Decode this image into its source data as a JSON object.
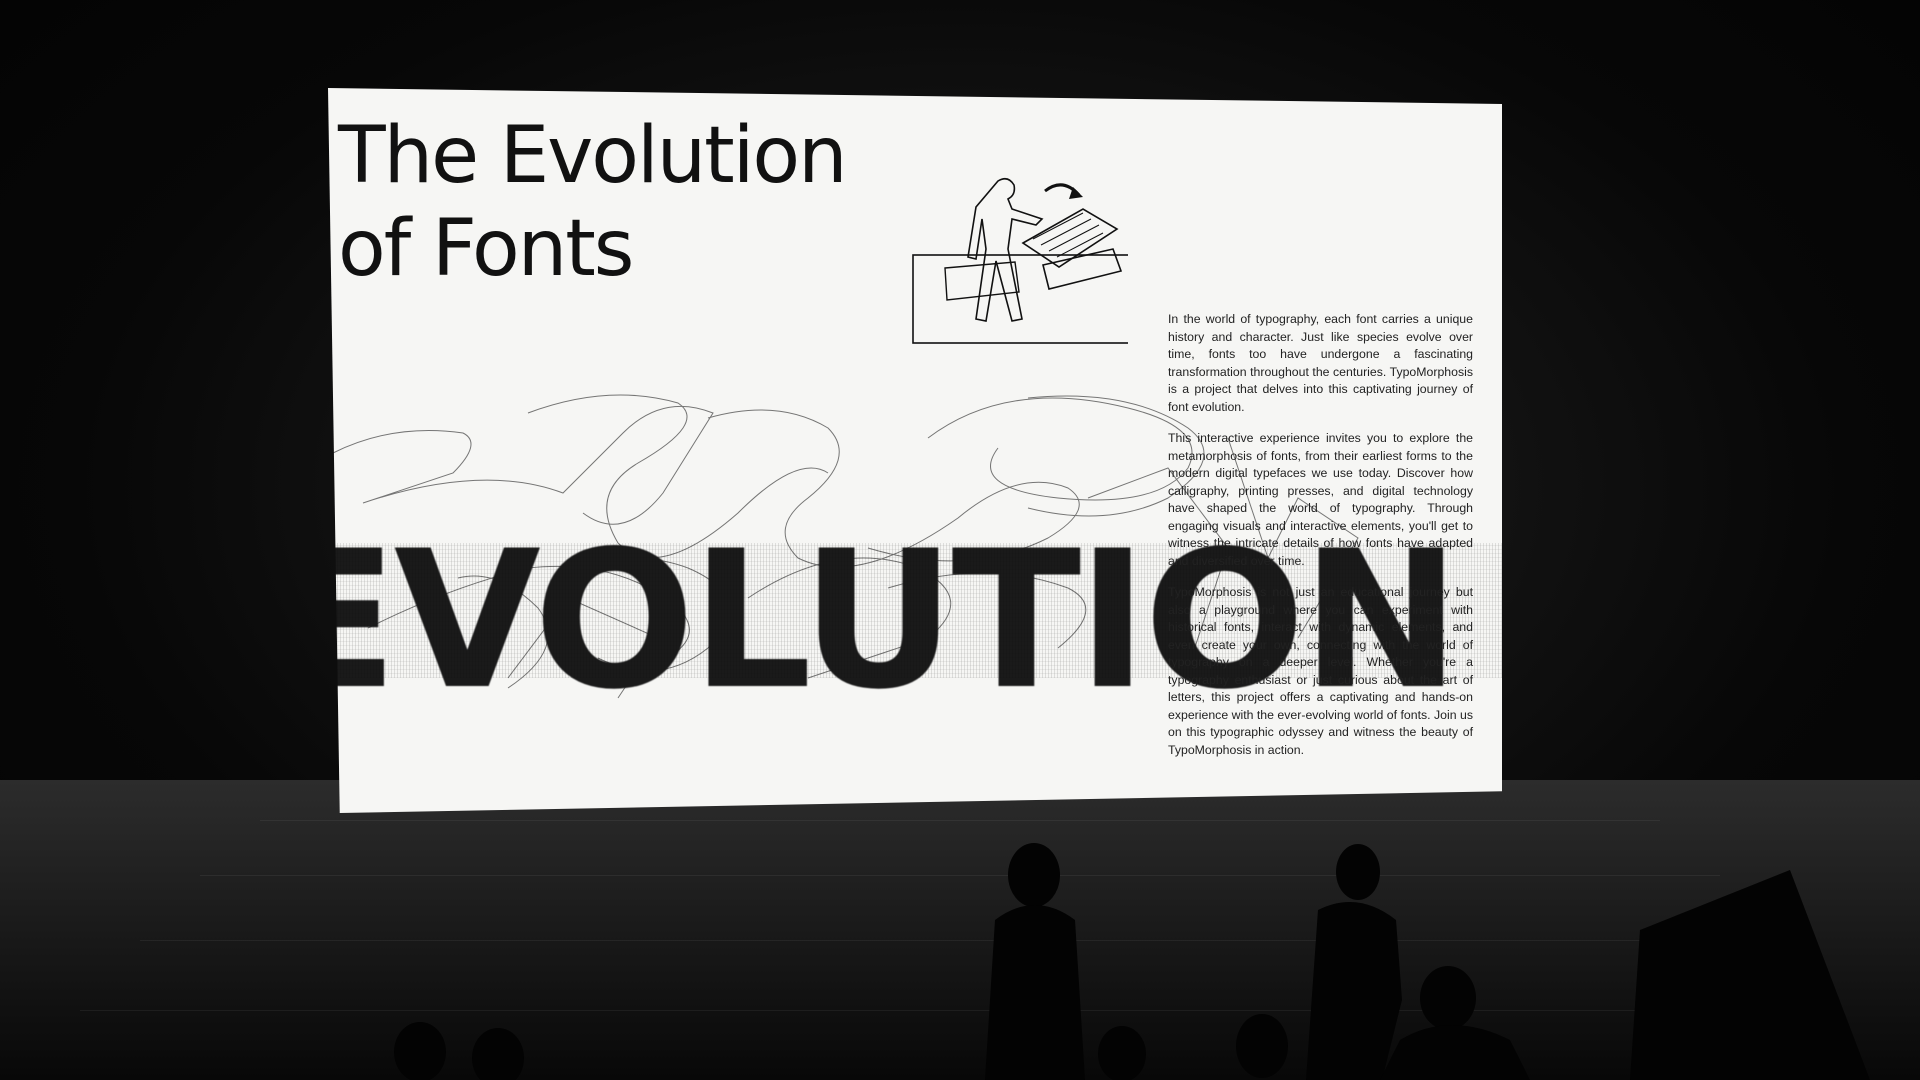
{
  "slide": {
    "title_line1": "The Evolution",
    "title_line2": "of Fonts",
    "big_word": "EVOLUTION",
    "paragraphs": [
      "In the world of typography, each font carries a unique history and character. Just like species evolve over time, fonts too have undergone a fascinating transformation throughout the centuries. TypoMorphosis is a project that delves into this captivating journey of font evolution.",
      "This interactive experience invites you to explore the metamorphosis of fonts, from their earliest forms to the modern digital typefaces we use today. Discover how calligraphy, printing presses, and digital technology have shaped the world of typography. Through engaging visuals and interactive elements, you'll get to witness the intricate details of how fonts have adapted and diversified over time.",
      "TypoMorphosis is not just an educational journey but also a playground where you can experiment with historical fonts, interact with dynamic elements, and even create your own, connecting with the world of typography on a deeper level. Whether you're a typography enthusiast or just curious about the art of letters, this project offers a captivating and hands-on experience with the ever-evolving world of fonts. Join us on this typographic odyssey and witness the beauty of TypoMorphosis in action."
    ]
  },
  "colors": {
    "screen": "#f6f6f4",
    "ink": "#111111",
    "room": "#050505"
  }
}
